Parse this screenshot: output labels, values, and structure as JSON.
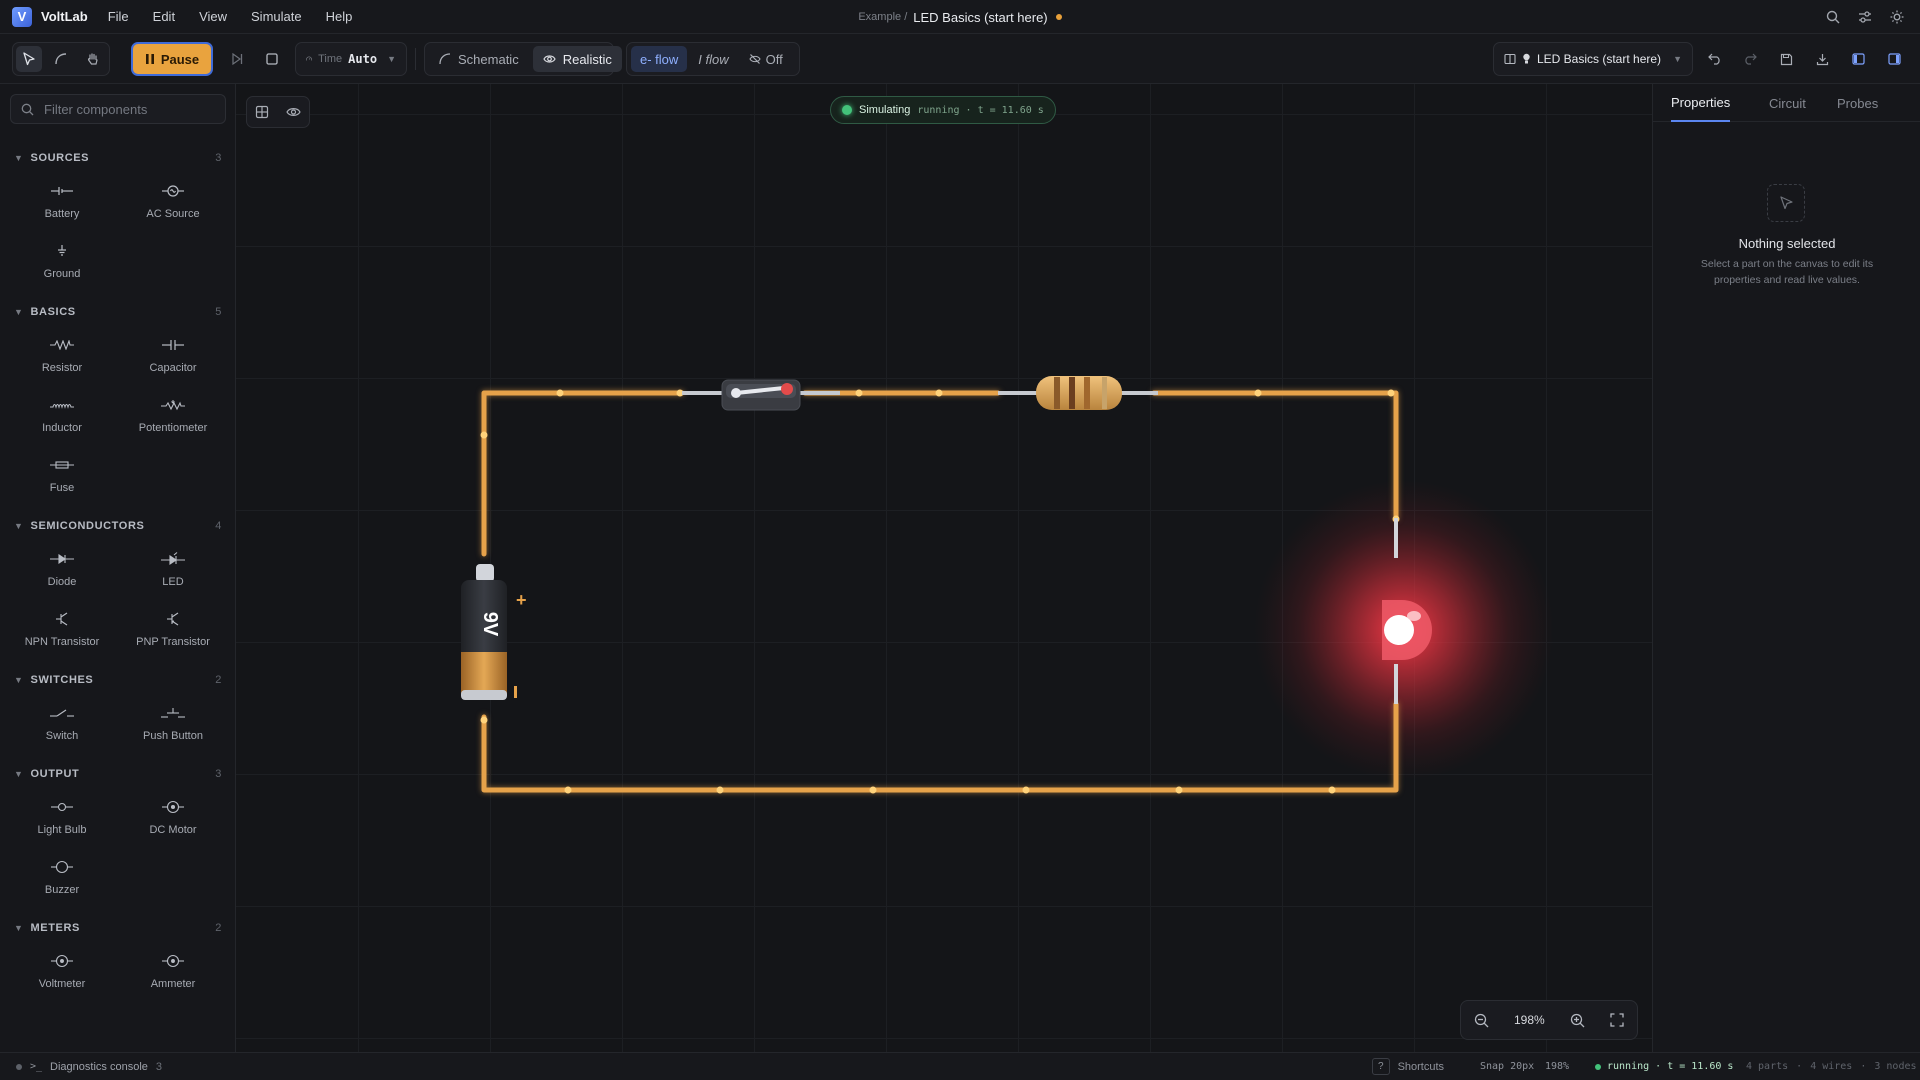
{
  "app": {
    "name": "VoltLab",
    "logo_letter": "V",
    "accent": "#e9a33e"
  },
  "menu": {
    "file": "File",
    "edit": "Edit",
    "view": "View",
    "simulate": "Simulate",
    "help": "Help"
  },
  "document": {
    "crumb": "Example /",
    "title": "LED Basics (start here)",
    "unsaved": true
  },
  "toolbar": {
    "pause_label": "Pause",
    "time_label": "Time",
    "time_value": "Auto",
    "view_schematic": "Schematic",
    "view_realistic": "Realistic",
    "active_view": "Realistic",
    "flow_electron": "e- flow",
    "flow_current": "I flow",
    "flow_off": "Off",
    "active_flow": "e- flow",
    "project_name": "LED Basics (start here)"
  },
  "sidebar": {
    "filter_placeholder": "Filter components",
    "categories": [
      {
        "name": "SOURCES",
        "count": "3",
        "items": [
          "Battery",
          "AC Source",
          "Ground"
        ]
      },
      {
        "name": "BASICS",
        "count": "5",
        "items": [
          "Resistor",
          "Capacitor",
          "Inductor",
          "Potentiometer",
          "Fuse"
        ]
      },
      {
        "name": "SEMICONDUCTORS",
        "count": "4",
        "items": [
          "Diode",
          "LED",
          "NPN Transistor",
          "PNP Transistor"
        ]
      },
      {
        "name": "SWITCHES",
        "count": "2",
        "items": [
          "Switch",
          "Push Button"
        ]
      },
      {
        "name": "OUTPUT",
        "count": "3",
        "items": [
          "Light Bulb",
          "DC Motor",
          "Buzzer"
        ]
      },
      {
        "name": "METERS",
        "count": "2",
        "items": [
          "Voltmeter",
          "Ammeter"
        ]
      }
    ]
  },
  "canvas": {
    "sim_status": "Simulating",
    "sim_detail": "running · t = 11.60 s",
    "battery_label": "9V",
    "battery_plus": "+",
    "zoom": "198%",
    "colors": {
      "wire": "#e6a24a",
      "led_glow": "#ff3b4a",
      "battery_body": "#2a2c31",
      "battery_copper": "#d79a4a"
    }
  },
  "right_panel": {
    "tabs": [
      "Properties",
      "Circuit",
      "Probes"
    ],
    "active_tab": "Properties",
    "empty_title": "Nothing selected",
    "empty_desc": "Select a part on the canvas to edit its properties and read live values."
  },
  "status": {
    "console_label": "Diagnostics console",
    "console_count": "3",
    "shortcuts_key": "?",
    "shortcuts": "Shortcuts",
    "snap": "Snap 20px",
    "zoom": "198%",
    "run_state": "running · t = 11.60 s",
    "parts": "4 parts",
    "wires": "4 wires",
    "nodes": "3 nodes"
  }
}
